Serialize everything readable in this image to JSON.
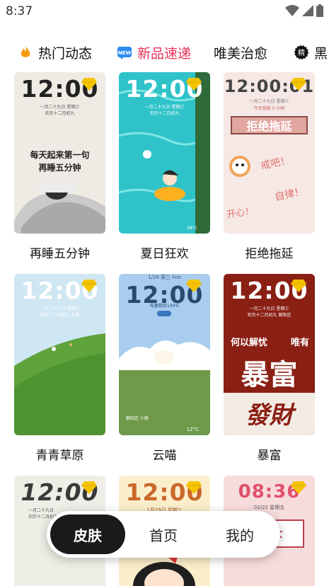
{
  "status": {
    "time": "8:37"
  },
  "tabs": [
    {
      "label": "热门动态",
      "icon": "fire-icon"
    },
    {
      "label": "新品速递",
      "icon": "new-badge-icon",
      "badge": "NEW",
      "active": true
    },
    {
      "label": "唯美治愈"
    },
    {
      "label": "黑",
      "icon": "jing-badge-icon",
      "badge": "精"
    }
  ],
  "cards": [
    {
      "title": "再睡五分钟",
      "clock": "12:00",
      "date": "一月二十九日  星期三",
      "lunar": "农历十二月初九",
      "art_text": [
        "每天起来第一句",
        "再睡五分钟"
      ]
    },
    {
      "title": "夏日狂欢",
      "clock": "12:00",
      "date": "一月二十九日  星期三",
      "lunar": "农历十二月初九",
      "corner": "28°C"
    },
    {
      "title": "拒绝拖延",
      "clock": "12:00:01",
      "date": "一月二十九日  星期三",
      "lunar": "今天别拖  5 小时",
      "art_text": [
        "拒绝拖延",
        "戒吧！",
        "自律！",
        "开心！"
      ]
    },
    {
      "title": "青青草原",
      "clock": "12:00",
      "date": "一月二十九日  星期三",
      "lunar": "农历十二月初九  立春"
    },
    {
      "title": "云喵",
      "clock": "12:00",
      "date": "电量剩余100%",
      "top": "1/28    周三    Feb",
      "corner": "12°C",
      "place": "朝阳区 小雨"
    },
    {
      "title": "暴富",
      "clock": "12:00",
      "date": "一月二十九日  星期三",
      "lunar": "农历十二月初九  朝阳区",
      "art_text": [
        "何以解忧",
        "唯有",
        "暴富",
        "發財"
      ]
    },
    {
      "title": "",
      "clock": "12:00",
      "date": "一月二十九日",
      "lunar": "农历十二月初九"
    },
    {
      "title": "",
      "clock": "12:00",
      "date": "1月29日  星期三"
    },
    {
      "title": "",
      "clock": "08:36",
      "date": "02/22    星期五",
      "art_text": [
        "女"
      ]
    }
  ],
  "bottom_nav": [
    {
      "label": "皮肤",
      "active": true
    },
    {
      "label": "首页"
    },
    {
      "label": "我的"
    }
  ],
  "colors": {
    "accent": "#e8325a",
    "nav_active": "#1a1a1a",
    "gem": "#f5c400"
  }
}
